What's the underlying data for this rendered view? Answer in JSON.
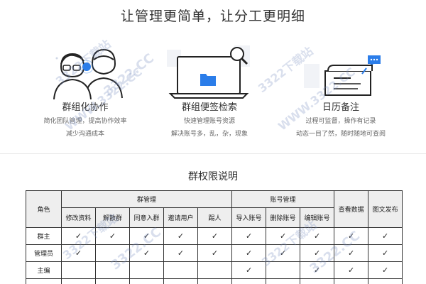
{
  "hero": {
    "title": "让管理更简单，让分工更明细"
  },
  "features": [
    {
      "title": "群组化协作",
      "lines": [
        "简化团队管理，提高协作效率",
        "减少沟通成本"
      ]
    },
    {
      "title": "群组便签检索",
      "lines": [
        "快速管理账号资源",
        "解决账号多，乱，杂，现象"
      ]
    },
    {
      "title": "日历备注",
      "lines": [
        "过程可监督，操作有记录",
        "动态一目了然，随时随地可查阅"
      ]
    }
  ],
  "permissions": {
    "title": "群权限说明",
    "role_header": "角色",
    "groups": [
      {
        "label": "群管理",
        "span": 5
      },
      {
        "label": "账号管理",
        "span": 3
      },
      {
        "label": "查看数据",
        "span": 1
      },
      {
        "label": "图文发布",
        "span": 1
      }
    ],
    "sub_headers": [
      "修改资料",
      "解散群",
      "同意入群",
      "邀请用户",
      "踢人",
      "导入账号",
      "删除账号",
      "编辑账号"
    ],
    "check": "✓",
    "rows": [
      {
        "role": "群主",
        "cells": [
          1,
          1,
          1,
          1,
          1,
          1,
          1,
          1,
          1,
          1
        ]
      },
      {
        "role": "管理员",
        "cells": [
          1,
          0,
          1,
          1,
          1,
          1,
          1,
          1,
          1,
          1
        ]
      },
      {
        "role": "主编",
        "cells": [
          0,
          0,
          0,
          0,
          0,
          1,
          0,
          1,
          1,
          1
        ]
      },
      {
        "role": "",
        "cells": [
          0,
          0,
          0,
          0,
          0,
          0,
          0,
          0,
          0,
          0
        ]
      }
    ]
  },
  "watermark": {
    "site": "3322下载站",
    "url": "WWW.3322.CC",
    "brand": "3322.CC"
  }
}
